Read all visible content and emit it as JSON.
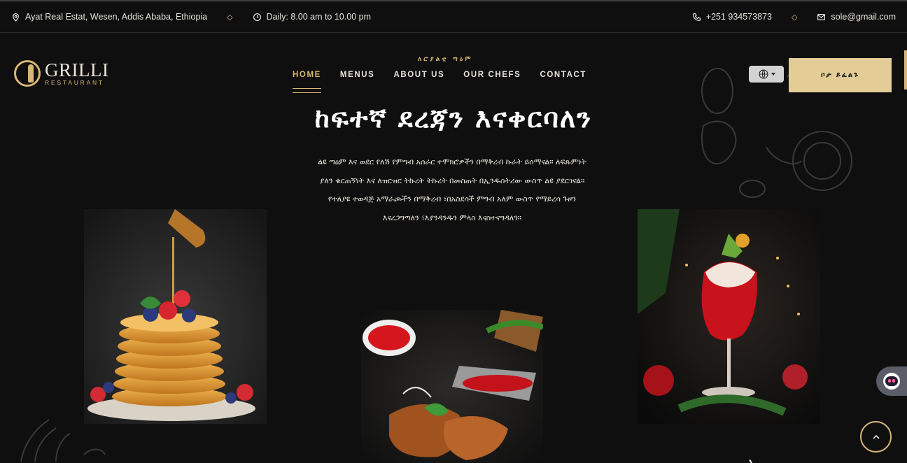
{
  "topbar": {
    "address": "Ayat Real Estat, Wesen, Addis Ababa, Ethiopia",
    "hours": "Daily: 8.00 am to 10.00 pm",
    "phone": "+251 934573873",
    "email": "sole@gmail.com",
    "separator": "◇"
  },
  "logo": {
    "name": "GRILLI",
    "tagline": "RESTAURANT"
  },
  "nav": {
    "tagline": "ለሮያልቲ ጣዕም",
    "items": [
      "HOME",
      "MENUS",
      "ABOUT US",
      "OUR CHEFS",
      "CONTACT"
    ],
    "active": "HOME"
  },
  "header": {
    "book_label": "ቦታ ይፈልጉ",
    "language_icon": "globe-icon"
  },
  "hero": {
    "title": "ከፍተኛ ደረጃን እናቀርባለን",
    "text": "ልዩ ጣዕም እና ወደር የለሽ የምግብ አሰራር ተሞክሮዎችን በማቅረብ ኩራት ይሰማናል። ለፍጹምነት ያለን ቁርጠኝነት እና ለዝርዝር ትኩረት ትኩረት በመስጠት በኢንዱስትሪው ውስጥ ልዩ ያደርገናል። የተለያዩ ተወዳጅ አማራጮችን በማቅረብ ፣በአስደሳች ምግብ አለም ውስጥ የማይረሳ ጉዞን እናረጋግጣለን ፣እያንዳንዱን ምላስ እናስተናግዳለን።"
  },
  "photos": [
    {
      "subject": "pancake stack with berries and honey"
    },
    {
      "subject": "grilled chicken with sauces"
    },
    {
      "subject": "red cocktail in glass"
    }
  ],
  "floating": {
    "chat_icon": "chat-bot-icon",
    "scroll_icon": "arrow-up-icon"
  },
  "footer_glyph": "ኡ"
}
